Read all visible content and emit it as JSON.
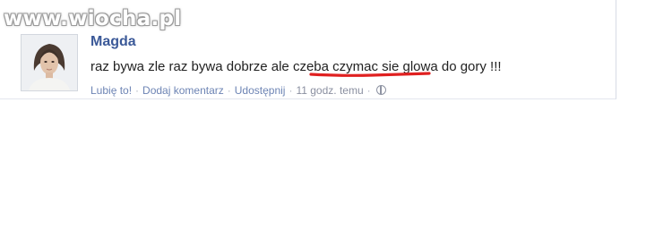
{
  "watermark": {
    "text": "www.wiocha.pl"
  },
  "post": {
    "author": "Magda",
    "message_before": "raz bywa zle raz bywa dobrze ale",
    "message_highlight": " czeba czymac sie",
    "message_after": " glowa do gory !!!",
    "highlight_color": "#e02020",
    "actions": {
      "like": "Lubię to!",
      "comment": "Dodaj komentarz",
      "share": "Udostępnij",
      "time": "11 godz. temu",
      "separator": "·"
    }
  },
  "colors": {
    "link": "#3b5998",
    "action_link": "#6d84b4",
    "muted": "#8a8fa0"
  }
}
